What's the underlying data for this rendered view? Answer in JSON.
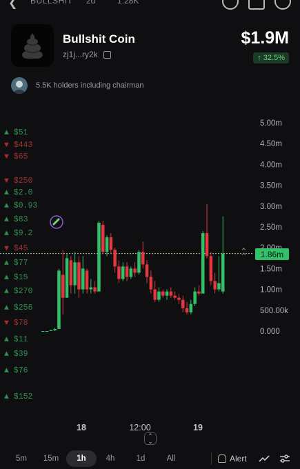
{
  "topbar": {
    "breadcrumb": "BULLSHIT",
    "age": "2d",
    "views": "1.28K"
  },
  "token": {
    "name": "Bullshit Coin",
    "address": "zj1j...ry2k",
    "market_cap": "$1.9M",
    "change": "↑ 32.5%"
  },
  "holders": {
    "text": "5.5K holders including chairman"
  },
  "chart_data": {
    "type": "candlestick",
    "y_ticks": [
      "5.00m",
      "4.50m",
      "4.00m",
      "3.50m",
      "3.00m",
      "2.50m",
      "2.00m",
      "1.50m",
      "1.00m",
      "500.00k",
      "0.000"
    ],
    "x_ticks": [
      "18",
      "12:00",
      "19"
    ],
    "current_price": "1.86m",
    "ylim": [
      0,
      5.0
    ],
    "candles": [
      {
        "o": 0.0,
        "h": 0.0,
        "l": 0.0,
        "c": 0.0
      },
      {
        "o": 0.0,
        "h": 0.0,
        "l": 0.0,
        "c": 0.0
      },
      {
        "o": 0.0,
        "h": 0.03,
        "l": 0.0,
        "c": 0.02
      },
      {
        "o": 0.02,
        "h": 0.08,
        "l": 0.0,
        "c": 0.05
      },
      {
        "o": 0.05,
        "h": 1.5,
        "l": 0.05,
        "c": 1.45
      },
      {
        "o": 1.35,
        "h": 1.95,
        "l": 0.4,
        "c": 0.8
      },
      {
        "o": 0.8,
        "h": 1.85,
        "l": 0.8,
        "c": 1.75
      },
      {
        "o": 1.7,
        "h": 1.8,
        "l": 0.9,
        "c": 1.1
      },
      {
        "o": 1.1,
        "h": 1.9,
        "l": 0.9,
        "c": 1.65
      },
      {
        "o": 1.65,
        "h": 1.8,
        "l": 0.8,
        "c": 1.0
      },
      {
        "o": 1.0,
        "h": 1.8,
        "l": 0.9,
        "c": 1.5
      },
      {
        "o": 1.45,
        "h": 1.5,
        "l": 0.9,
        "c": 1.0
      },
      {
        "o": 1.0,
        "h": 1.25,
        "l": 0.9,
        "c": 1.05
      },
      {
        "o": 1.05,
        "h": 1.2,
        "l": 0.9,
        "c": 0.95
      },
      {
        "o": 0.95,
        "h": 2.65,
        "l": 0.95,
        "c": 2.6
      },
      {
        "o": 2.55,
        "h": 2.65,
        "l": 1.85,
        "c": 1.9
      },
      {
        "o": 1.9,
        "h": 2.3,
        "l": 1.8,
        "c": 2.25
      },
      {
        "o": 2.25,
        "h": 2.35,
        "l": 1.85,
        "c": 1.95
      },
      {
        "o": 1.95,
        "h": 2.0,
        "l": 1.4,
        "c": 1.55
      },
      {
        "o": 1.55,
        "h": 1.7,
        "l": 1.15,
        "c": 1.25
      },
      {
        "o": 1.25,
        "h": 1.65,
        "l": 1.2,
        "c": 1.55
      },
      {
        "o": 1.55,
        "h": 1.65,
        "l": 1.2,
        "c": 1.3
      },
      {
        "o": 1.3,
        "h": 1.55,
        "l": 1.25,
        "c": 1.5
      },
      {
        "o": 1.5,
        "h": 1.65,
        "l": 1.3,
        "c": 1.4
      },
      {
        "o": 1.4,
        "h": 1.95,
        "l": 1.35,
        "c": 1.9
      },
      {
        "o": 1.9,
        "h": 2.15,
        "l": 1.5,
        "c": 1.6
      },
      {
        "o": 1.6,
        "h": 1.7,
        "l": 1.15,
        "c": 1.3
      },
      {
        "o": 1.3,
        "h": 1.45,
        "l": 0.9,
        "c": 1.0
      },
      {
        "o": 1.0,
        "h": 1.2,
        "l": 0.7,
        "c": 0.75
      },
      {
        "o": 0.75,
        "h": 1.05,
        "l": 0.7,
        "c": 0.95
      },
      {
        "o": 0.95,
        "h": 1.0,
        "l": 0.8,
        "c": 0.85
      },
      {
        "o": 0.85,
        "h": 1.0,
        "l": 0.75,
        "c": 0.95
      },
      {
        "o": 0.95,
        "h": 1.05,
        "l": 0.8,
        "c": 0.85
      },
      {
        "o": 0.85,
        "h": 0.95,
        "l": 0.75,
        "c": 0.8
      },
      {
        "o": 0.8,
        "h": 0.9,
        "l": 0.65,
        "c": 0.75
      },
      {
        "o": 0.75,
        "h": 0.85,
        "l": 0.45,
        "c": 0.55
      },
      {
        "o": 0.55,
        "h": 0.7,
        "l": 0.4,
        "c": 0.45
      },
      {
        "o": 0.45,
        "h": 0.75,
        "l": 0.4,
        "c": 0.65
      },
      {
        "o": 0.65,
        "h": 1.05,
        "l": 0.6,
        "c": 0.95
      },
      {
        "o": 0.95,
        "h": 1.1,
        "l": 0.85,
        "c": 0.9
      },
      {
        "o": 0.9,
        "h": 2.4,
        "l": 0.9,
        "c": 2.35
      },
      {
        "o": 2.35,
        "h": 3.05,
        "l": 1.75,
        "c": 1.8
      },
      {
        "o": 1.8,
        "h": 1.9,
        "l": 1.1,
        "c": 1.2
      },
      {
        "o": 1.2,
        "h": 1.4,
        "l": 0.9,
        "c": 1.0
      },
      {
        "o": 1.0,
        "h": 1.8,
        "l": 0.95,
        "c": 1.15
      },
      {
        "o": 0.95,
        "h": 2.75,
        "l": 0.9,
        "c": 1.86
      }
    ],
    "trade_labels": [
      {
        "side": "buy",
        "text": "$51"
      },
      {
        "side": "sell",
        "text": "$443"
      },
      {
        "side": "sell",
        "text": "$65"
      },
      {
        "side": "sell",
        "text": "$250"
      },
      {
        "side": "buy",
        "text": "$2.0"
      },
      {
        "side": "buy",
        "text": "$0.93"
      },
      {
        "side": "buy",
        "text": "$83"
      },
      {
        "side": "buy",
        "text": "$9.2"
      },
      {
        "side": "sell",
        "text": "$45"
      },
      {
        "side": "buy",
        "text": "$77"
      },
      {
        "side": "buy",
        "text": "$15"
      },
      {
        "side": "buy",
        "text": "$270"
      },
      {
        "side": "buy",
        "text": "$256"
      },
      {
        "side": "sell",
        "text": "$78"
      },
      {
        "side": "buy",
        "text": "$11"
      },
      {
        "side": "buy",
        "text": "$39"
      },
      {
        "side": "buy",
        "text": "$76"
      },
      {
        "side": "buy",
        "text": "$152"
      }
    ],
    "colors": {
      "up": "#32c069",
      "down": "#e0393e",
      "buy_label": "#2f8f4e",
      "sell_label": "#a0302f"
    }
  },
  "timeframes": [
    "5m",
    "15m",
    "1h",
    "4h",
    "1d",
    "All"
  ],
  "active_timeframe": "1h",
  "actions": {
    "alert": "Alert"
  }
}
